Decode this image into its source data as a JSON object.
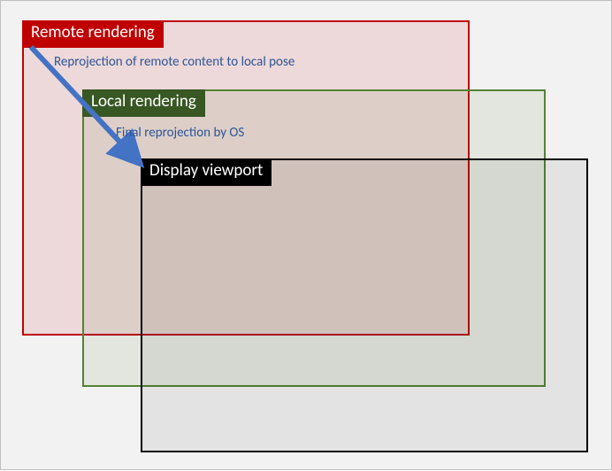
{
  "diagram": {
    "remote": {
      "label": "Remote rendering"
    },
    "local": {
      "label": "Local rendering"
    },
    "display": {
      "label": "Display viewport"
    },
    "annot1": "Reprojection of remote content to local pose",
    "annot2": "Final reprojection by OS",
    "arrow_color": "#4472c4"
  }
}
